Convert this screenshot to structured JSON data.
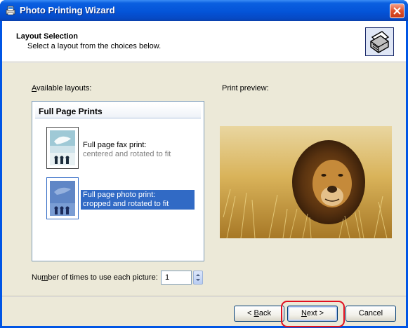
{
  "window": {
    "title": "Photo Printing Wizard"
  },
  "header": {
    "title": "Layout Selection",
    "subtitle": "Select a layout from the choices below."
  },
  "layouts": {
    "label_prefix": "",
    "label_accel": "A",
    "label_rest": "vailable layouts:",
    "group_title": "Full Page Prints",
    "items": [
      {
        "title": "Full page fax print:",
        "sub": "centered and rotated to fit",
        "selected": false
      },
      {
        "title": "Full page photo print:",
        "sub": "cropped and rotated to fit",
        "selected": true
      }
    ]
  },
  "preview": {
    "label": "Print preview:",
    "image_subject": "lion-in-grass"
  },
  "copies": {
    "label_prefix": "Nu",
    "label_accel": "m",
    "label_rest": "ber of times to use each picture:",
    "value": "1"
  },
  "buttons": {
    "back_prefix": "< ",
    "back_accel": "B",
    "back_rest": "ack",
    "next_accel": "N",
    "next_rest": "ext >",
    "cancel": "Cancel"
  },
  "colors": {
    "titlebar": "#0454d8",
    "selection": "#316ac5",
    "dialog_bg": "#ece9d8",
    "highlight_ring": "#e01020"
  }
}
